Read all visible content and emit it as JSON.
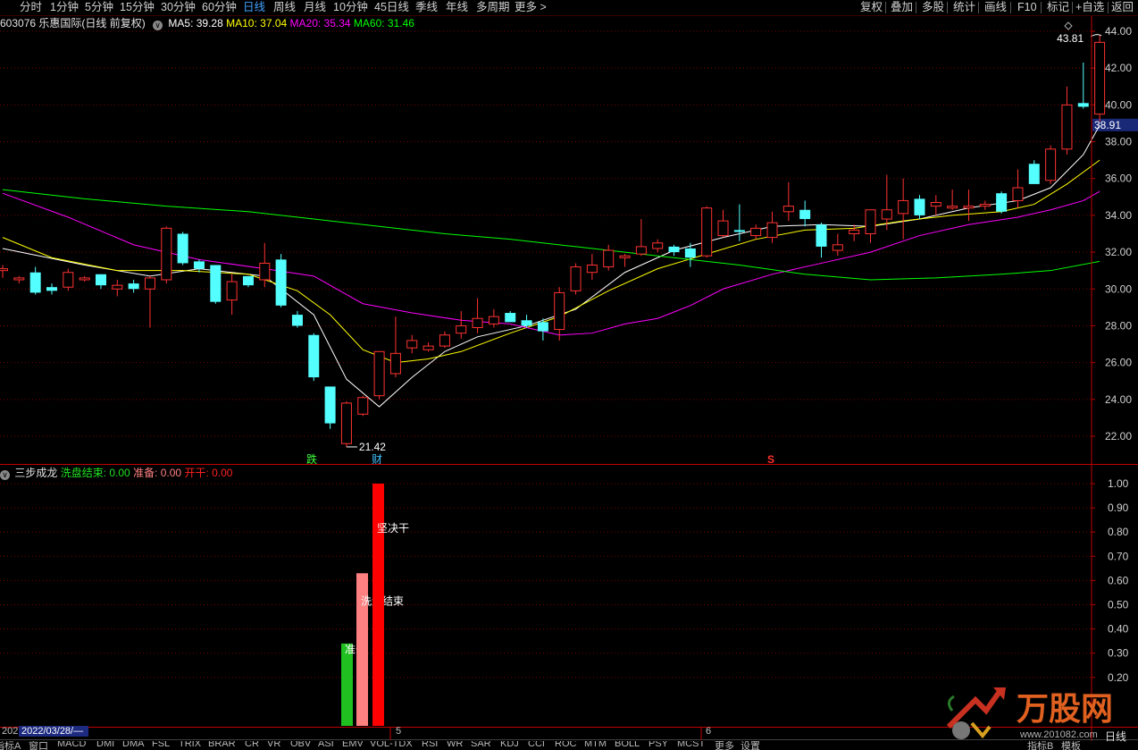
{
  "toolbar": {
    "periods": [
      "分时",
      "1分钟",
      "5分钟",
      "15分钟",
      "30分钟",
      "60分钟",
      "日线",
      "周线",
      "月线",
      "10分钟",
      "45日线",
      "季线",
      "年线",
      "多周期",
      "更多 >"
    ],
    "active_period": "日线",
    "right_buttons": [
      "复权",
      "叠加",
      "多股",
      "统计",
      "画线",
      "F10",
      "标记",
      "+自选",
      "返回"
    ]
  },
  "info": {
    "stock": "603076 乐惠国际(日线 前复权)",
    "ma5_label": "MA5: ",
    "ma5": "39.28",
    "ma10_label": "MA10: ",
    "ma10": "37.04",
    "ma20_label": "MA20: ",
    "ma20": "35.34",
    "ma60_label": "MA60: ",
    "ma60": "31.46"
  },
  "indicator": {
    "name": "三步成龙",
    "l1": "洗盘结束: ",
    "v1": "0.00",
    "l2": "准备: ",
    "v2": "0.00",
    "l3": "开干: ",
    "v3": "0.00"
  },
  "colors": {
    "up": "#ff3232",
    "down": "#54ffff",
    "ma5": "#ffffff",
    "ma10": "#ffff00",
    "ma20": "#ff00ff",
    "ma60": "#00ff00",
    "grid": "#7a0000",
    "axis": "#c00000"
  },
  "chart_data": {
    "type": "candlestick",
    "y_ticks": [
      "44.00",
      "42.00",
      "40.00",
      "38.00",
      "36.00",
      "34.00",
      "32.00",
      "30.00",
      "28.00",
      "26.00",
      "24.00",
      "22.00"
    ],
    "current_price": "38.91",
    "ylim": [
      20.8,
      44.8
    ],
    "candles": [
      [
        31.0,
        31.3,
        30.6,
        31.1
      ],
      [
        30.5,
        30.7,
        30.3,
        30.6
      ],
      [
        30.9,
        31.2,
        29.7,
        29.8
      ],
      [
        30.1,
        30.3,
        29.7,
        29.9
      ],
      [
        30.1,
        31.1,
        29.9,
        30.9
      ],
      [
        30.5,
        30.7,
        30.4,
        30.6
      ],
      [
        30.8,
        30.8,
        30.0,
        30.2
      ],
      [
        30.0,
        30.5,
        29.6,
        30.2
      ],
      [
        30.3,
        30.5,
        29.8,
        30.0
      ],
      [
        30.0,
        30.7,
        27.9,
        30.6
      ],
      [
        30.5,
        33.4,
        30.3,
        33.3
      ],
      [
        33.0,
        33.1,
        31.3,
        31.4
      ],
      [
        31.5,
        31.6,
        30.9,
        31.1
      ],
      [
        31.3,
        31.3,
        29.2,
        29.3
      ],
      [
        29.4,
        30.8,
        28.6,
        30.4
      ],
      [
        30.7,
        30.7,
        30.1,
        30.2
      ],
      [
        30.5,
        32.5,
        30.1,
        31.4
      ],
      [
        31.6,
        31.9,
        29.0,
        29.1
      ],
      [
        28.6,
        28.8,
        27.9,
        28.0
      ],
      [
        27.5,
        27.6,
        25.0,
        25.2
      ],
      [
        24.7,
        24.7,
        22.4,
        22.7
      ],
      [
        21.6,
        23.9,
        21.4,
        23.8
      ],
      [
        23.2,
        24.2,
        23.1,
        24.1
      ],
      [
        24.2,
        26.6,
        24.0,
        26.6
      ],
      [
        25.4,
        28.5,
        25.2,
        26.5
      ],
      [
        26.8,
        27.5,
        26.5,
        27.2
      ],
      [
        26.7,
        27.1,
        26.6,
        26.9
      ],
      [
        26.9,
        27.7,
        26.8,
        27.5
      ],
      [
        27.6,
        28.8,
        27.3,
        28.0
      ],
      [
        27.9,
        29.5,
        27.6,
        28.4
      ],
      [
        28.1,
        28.9,
        27.9,
        28.5
      ],
      [
        28.7,
        28.8,
        28.3,
        28.2
      ],
      [
        28.3,
        28.6,
        27.9,
        28.0
      ],
      [
        28.2,
        28.4,
        27.2,
        27.7
      ],
      [
        27.8,
        30.1,
        27.2,
        29.8
      ],
      [
        29.9,
        31.4,
        29.7,
        31.2
      ],
      [
        30.9,
        31.9,
        30.5,
        31.3
      ],
      [
        31.2,
        32.4,
        31.0,
        32.1
      ],
      [
        31.7,
        31.9,
        31.2,
        31.8
      ],
      [
        31.9,
        33.8,
        31.8,
        32.3
      ],
      [
        32.2,
        32.7,
        32.0,
        32.5
      ],
      [
        32.3,
        32.4,
        31.8,
        32.0
      ],
      [
        32.2,
        32.5,
        31.2,
        31.7
      ],
      [
        31.8,
        34.5,
        31.7,
        34.4
      ],
      [
        32.9,
        34.3,
        32.8,
        33.7
      ],
      [
        33.2,
        34.6,
        32.6,
        33.1
      ],
      [
        32.9,
        33.5,
        32.7,
        33.3
      ],
      [
        32.8,
        34.2,
        32.5,
        33.6
      ],
      [
        34.2,
        35.8,
        33.7,
        34.5
      ],
      [
        34.3,
        34.8,
        33.4,
        33.8
      ],
      [
        33.5,
        33.6,
        31.7,
        32.3
      ],
      [
        32.1,
        33.0,
        31.8,
        32.4
      ],
      [
        33.0,
        33.5,
        32.6,
        33.2
      ],
      [
        33.0,
        34.3,
        32.5,
        34.3
      ],
      [
        33.8,
        36.2,
        33.2,
        34.3
      ],
      [
        34.1,
        36.0,
        32.7,
        34.8
      ],
      [
        34.9,
        35.1,
        33.8,
        34.0
      ],
      [
        34.5,
        35.1,
        34.0,
        34.7
      ],
      [
        34.4,
        35.4,
        34.3,
        34.5
      ],
      [
        34.4,
        35.4,
        33.7,
        34.5
      ],
      [
        34.5,
        34.8,
        34.3,
        34.6
      ],
      [
        35.2,
        35.3,
        34.1,
        34.2
      ],
      [
        34.8,
        36.5,
        34.4,
        35.5
      ],
      [
        36.8,
        37.0,
        35.7,
        35.7
      ],
      [
        35.9,
        37.8,
        35.7,
        37.6
      ],
      [
        37.6,
        41.0,
        37.3,
        40.0
      ],
      [
        40.1,
        42.3,
        39.8,
        39.9
      ],
      [
        39.5,
        43.8,
        39.1,
        43.4
      ]
    ],
    "ma_series": {
      "MA5": [
        [
          0,
          32.2
        ],
        [
          5,
          31.3
        ],
        [
          9,
          30.7
        ],
        [
          12,
          31.1
        ],
        [
          16,
          30.7
        ],
        [
          19,
          28.6
        ],
        [
          21,
          25.1
        ],
        [
          23,
          23.6
        ],
        [
          25,
          25.2
        ],
        [
          27,
          26.6
        ],
        [
          29,
          27.4
        ],
        [
          32,
          28.0
        ],
        [
          35,
          28.9
        ],
        [
          38,
          30.9
        ],
        [
          41,
          32.1
        ],
        [
          44,
          32.8
        ],
        [
          47,
          33.4
        ],
        [
          50,
          33.5
        ],
        [
          53,
          33.4
        ],
        [
          56,
          33.8
        ],
        [
          59,
          34.4
        ],
        [
          62,
          34.8
        ],
        [
          64,
          35.5
        ],
        [
          66,
          37.3
        ],
        [
          67,
          38.9
        ]
      ],
      "MA10": [
        [
          0,
          32.8
        ],
        [
          3,
          31.7
        ],
        [
          7,
          31.0
        ],
        [
          11,
          31.0
        ],
        [
          15,
          30.8
        ],
        [
          18,
          29.9
        ],
        [
          20,
          28.6
        ],
        [
          22,
          26.7
        ],
        [
          24,
          26.0
        ],
        [
          26,
          26.2
        ],
        [
          28,
          26.6
        ],
        [
          31,
          27.6
        ],
        [
          34,
          28.5
        ],
        [
          37,
          29.9
        ],
        [
          40,
          31.1
        ],
        [
          43,
          31.9
        ],
        [
          46,
          32.7
        ],
        [
          49,
          33.2
        ],
        [
          52,
          33.3
        ],
        [
          55,
          33.7
        ],
        [
          58,
          34.0
        ],
        [
          61,
          34.2
        ],
        [
          63,
          34.6
        ],
        [
          65,
          35.7
        ],
        [
          67,
          37.0
        ]
      ],
      "MA20": [
        [
          0,
          35.2
        ],
        [
          4,
          33.9
        ],
        [
          8,
          32.4
        ],
        [
          12,
          31.6
        ],
        [
          16,
          31.1
        ],
        [
          19,
          30.7
        ],
        [
          22,
          29.2
        ],
        [
          25,
          28.7
        ],
        [
          28,
          28.3
        ],
        [
          31,
          28.1
        ],
        [
          34,
          27.5
        ],
        [
          36,
          27.6
        ],
        [
          38,
          28.1
        ],
        [
          40,
          28.4
        ],
        [
          42,
          29.1
        ],
        [
          44,
          30.0
        ],
        [
          47,
          30.8
        ],
        [
          50,
          31.4
        ],
        [
          53,
          32.0
        ],
        [
          56,
          32.9
        ],
        [
          59,
          33.5
        ],
        [
          62,
          33.9
        ],
        [
          64,
          34.3
        ],
        [
          66,
          34.8
        ],
        [
          67,
          35.3
        ]
      ],
      "MA60": [
        [
          0,
          35.4
        ],
        [
          5,
          34.9
        ],
        [
          10,
          34.5
        ],
        [
          15,
          34.2
        ],
        [
          19,
          33.8
        ],
        [
          23,
          33.4
        ],
        [
          27,
          33.0
        ],
        [
          31,
          32.7
        ],
        [
          35,
          32.3
        ],
        [
          40,
          31.8
        ],
        [
          45,
          31.3
        ],
        [
          49,
          30.8
        ],
        [
          53,
          30.5
        ],
        [
          57,
          30.6
        ],
        [
          61,
          30.8
        ],
        [
          64,
          31.0
        ],
        [
          67,
          31.5
        ]
      ]
    },
    "annotations": {
      "low": "21.42",
      "high": "43.81",
      "mark_die": "跌",
      "mark_cai": "财",
      "mark_s": "S"
    },
    "indicator_ticks": [
      "1.00",
      "0.90",
      "0.80",
      "0.70",
      "0.60",
      "0.50",
      "0.40",
      "0.30",
      "0.20"
    ],
    "indicator_bars": [
      {
        "name": "准备",
        "value": 0.34,
        "color": "#20c020",
        "label": "准备"
      },
      {
        "name": "洗盘结束",
        "value": 0.63,
        "color": "#ff8080",
        "label": "洗盘结束"
      },
      {
        "name": "开干",
        "value": 1.0,
        "color": "#ff0000",
        "label": "坚决干"
      }
    ]
  },
  "datebar": {
    "year": "202",
    "date": "2022/03/28/—",
    "m5": "5",
    "m6": "6"
  },
  "tabs": [
    "指标A",
    "窗口",
    "MACD",
    "DMI",
    "DMA",
    "FSL",
    "TRIX",
    "BRAR",
    "CR",
    "VR",
    "OBV",
    "ASI",
    "EMV",
    "VOL-TDX",
    "RSI",
    "WR",
    "SAR",
    "KDJ",
    "CCI",
    "ROC",
    "MTM",
    "BOLL",
    "PSY",
    "MCST",
    "更多",
    "设置"
  ],
  "tabs_right": [
    "指标B",
    "模板"
  ],
  "bottom_right": "日线",
  "watermark": {
    "brand": "万股网",
    "url": "www.201082.com"
  }
}
